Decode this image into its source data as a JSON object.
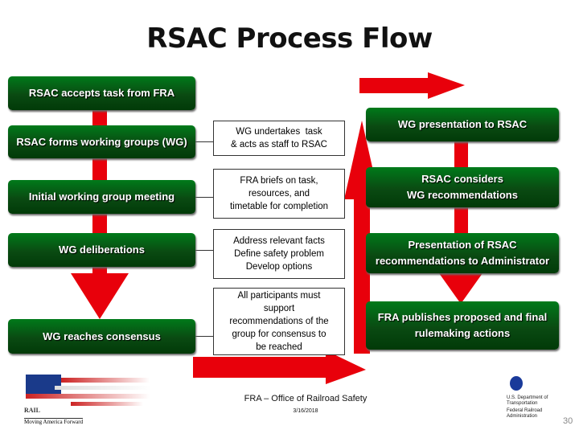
{
  "title": "RSAC Process Flow",
  "left_steps": [
    "RSAC accepts task from FRA",
    "RSAC forms working groups (WG)",
    "Initial working group meeting",
    "WG deliberations",
    "WG reaches consensus"
  ],
  "middle_notes": [
    "WG undertakes  task\n& acts as staff to RSAC",
    "FRA briefs on task,\nresources, and\ntimetable for completion",
    "Address relevant facts\nDefine safety problem\nDevelop options",
    "All participants must\nsupport\nrecommendations of the\ngroup for consensus to\nbe reached"
  ],
  "right_steps": [
    "WG presentation to RSAC",
    "RSAC considers\nWG recommendations",
    "Presentation of RSAC\nrecommendations to Administrator",
    "FRA publishes proposed and final\nrulemaking actions"
  ],
  "colors": {
    "arrow": "#e8000b",
    "box": "#0a4a12"
  },
  "footer": {
    "office": "FRA – Office of Railroad Safety",
    "date": "3/16/2018",
    "page": "30",
    "left_logo": {
      "label": "RAIL",
      "tagline": "Moving America Forward"
    },
    "right_logo": {
      "dept": "U.S. Department of Transportation",
      "agency": "Federal Railroad Administration"
    }
  }
}
